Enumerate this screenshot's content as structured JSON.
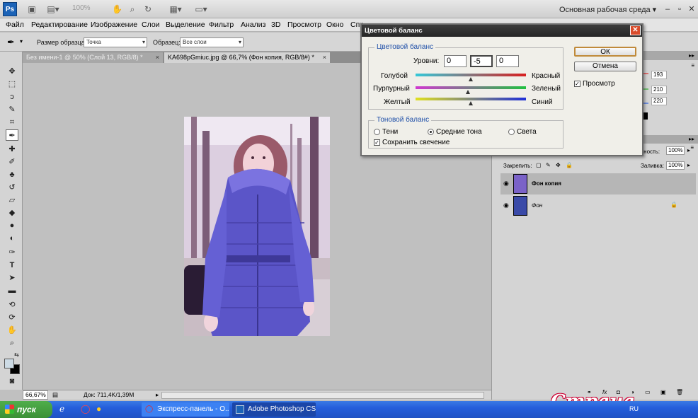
{
  "app": {
    "logo": "Ps",
    "zoom_display": "100%",
    "workspace": "Основная рабочая среда"
  },
  "menu": [
    "Файл",
    "Редактирование",
    "Изображение",
    "Слои",
    "Выделение",
    "Фильтр",
    "Анализ",
    "3D",
    "Просмотр",
    "Окно",
    "Спр"
  ],
  "options": {
    "sample_size_label": "Размер образца:",
    "sample_size_value": "Точка",
    "sample_label": "Образец:",
    "sample_value": "Все слои"
  },
  "tabs": [
    {
      "label": "Без имени-1 @ 50% (Слой 13, RGB/8) *"
    },
    {
      "label": "KA698pGmiuc.jpg @ 66,7% (Фон копия, RGB/8#) *"
    }
  ],
  "status": {
    "zoom": "66,67%",
    "doc": "Док: 711,4K/1,39M"
  },
  "dialog": {
    "title": "Цветовой баланс",
    "color_group": "Цветовой баланс",
    "levels_label": "Уровни:",
    "levels": [
      "0",
      "-5",
      "0"
    ],
    "sliders": [
      {
        "left": "Голубой",
        "right": "Красный",
        "value": 0,
        "colors": [
          "#35c8d8",
          "#d82020"
        ]
      },
      {
        "left": "Пурпурный",
        "right": "Зеленый",
        "value": -5,
        "colors": [
          "#d038d0",
          "#20c040"
        ]
      },
      {
        "left": "Желтый",
        "right": "Синий",
        "value": 0,
        "colors": [
          "#e0e020",
          "#2030d8"
        ]
      }
    ],
    "tone_group": "Тоновой баланс",
    "tones": [
      {
        "label": "Тени",
        "selected": false
      },
      {
        "label": "Средние тона",
        "selected": true
      },
      {
        "label": "Света",
        "selected": false
      }
    ],
    "preserve_luminosity": "Сохранить свечение",
    "ok": "ОК",
    "cancel": "Отмена",
    "preview": "Просмотр"
  },
  "right_panel": {
    "color_values": [
      "193",
      "210",
      "220"
    ],
    "opacity_label": "чность:",
    "opacity_value": "100%",
    "lock_label": "Закрепить:",
    "fill_label": "Заливка:",
    "fill_value": "100%",
    "layers": [
      {
        "name": "Фон копия",
        "active": true
      },
      {
        "name": "Фон",
        "active": false
      }
    ]
  },
  "taskbar": {
    "start": "пуск",
    "tasks": [
      "Экспресс-панель - О...",
      "Adobe Photoshop CS..."
    ],
    "lang": "RU"
  },
  "watermark": "Страна Мам.ру"
}
